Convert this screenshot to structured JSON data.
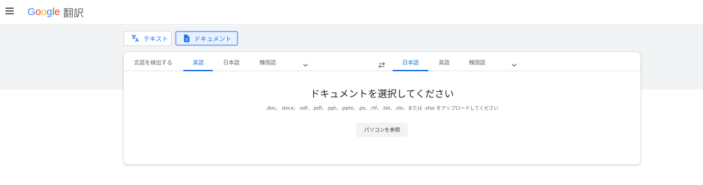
{
  "header": {
    "logo_letters": [
      "G",
      "o",
      "o",
      "g",
      "l",
      "e"
    ],
    "product": "翻訳"
  },
  "modes": {
    "text_label": "テキスト",
    "document_label": "ドキュメント"
  },
  "source_langs": {
    "detect": "言語を検出する",
    "items": [
      "英語",
      "日本語",
      "韓国語"
    ],
    "active": "英語"
  },
  "target_langs": {
    "items": [
      "日本語",
      "英語",
      "韓国語"
    ],
    "active": "日本語"
  },
  "upload": {
    "heading": "ドキュメントを選択してください",
    "formats": ".doc、.docx、.odf、.pdf、.ppt、.pptx、.ps、.rtf、.txt、.xls、または .xlsx をアップロードしてください",
    "browse_label": "パソコンを参照"
  },
  "colors": {
    "accent": "#1a73e8",
    "band": "#f1f3f4"
  },
  "icons": [
    "menu-icon",
    "translate-icon",
    "document-icon",
    "swap-icon",
    "chevron-down-icon"
  ]
}
